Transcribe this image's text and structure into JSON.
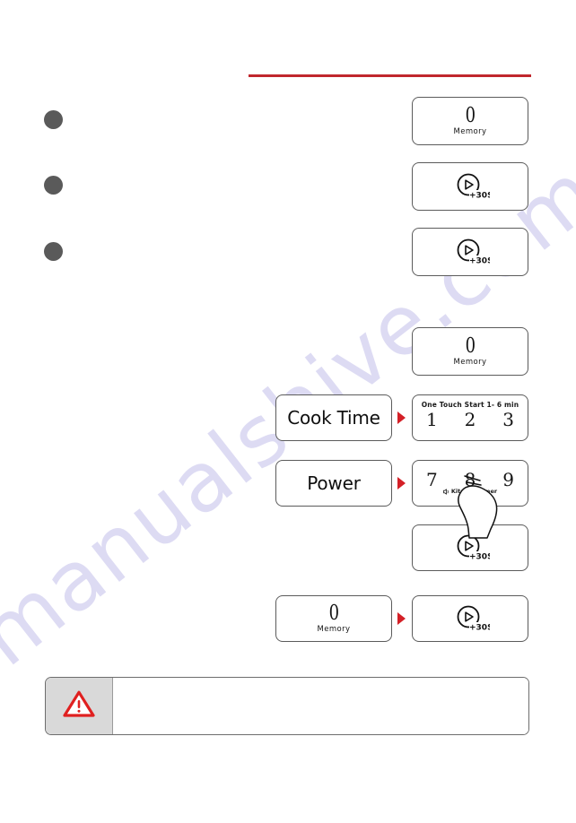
{
  "page": {
    "background_color": "#ffffff",
    "accent_red": "#c0272d",
    "arrow_red": "#d42027",
    "bullet_color": "#5a5a5a",
    "note_icon_bg": "#d9d9d9"
  },
  "watermark": {
    "text": "manualshive.com",
    "color": "#c9c6ec"
  },
  "header": {
    "rule_label": "section-rule"
  },
  "bullets": [
    {
      "name": "bullet-1"
    },
    {
      "name": "bullet-2"
    },
    {
      "name": "bullet-3"
    }
  ],
  "keys": {
    "memory": {
      "digit": "0",
      "label": "Memory",
      "icon": "memory-key-icon"
    },
    "start30": {
      "label": "+30S",
      "icon": "play-plus-30s-icon"
    },
    "cook_time": {
      "label": "Cook Time"
    },
    "power": {
      "label": "Power"
    },
    "one_touch": {
      "caption": "One Touch Start 1- 6 min",
      "digits": [
        "1",
        "2",
        "3"
      ]
    },
    "power_pad": {
      "digits": [
        "7",
        "8",
        "9"
      ],
      "sub_label": "Kitchen Timer",
      "sub_icon": "speaker-icon"
    }
  },
  "steps": [
    {
      "name": "step-memory-single",
      "key": "memory"
    },
    {
      "name": "step-start30-single-a",
      "key": "start30"
    },
    {
      "name": "step-start30-single-b",
      "key": "start30"
    },
    {
      "name": "step-memory-single-2",
      "key": "memory"
    },
    {
      "name": "step-cook-time-to-one-touch",
      "from": "cook_time",
      "to": "one_touch"
    },
    {
      "name": "step-power-to-power-pad",
      "from": "power",
      "to": "power_pad"
    },
    {
      "name": "step-start30-single-c",
      "key": "start30"
    },
    {
      "name": "step-memory-to-start30",
      "from": "memory",
      "to": "start30"
    }
  ],
  "note": {
    "icon": "warning-triangle-icon",
    "body_text": ""
  }
}
